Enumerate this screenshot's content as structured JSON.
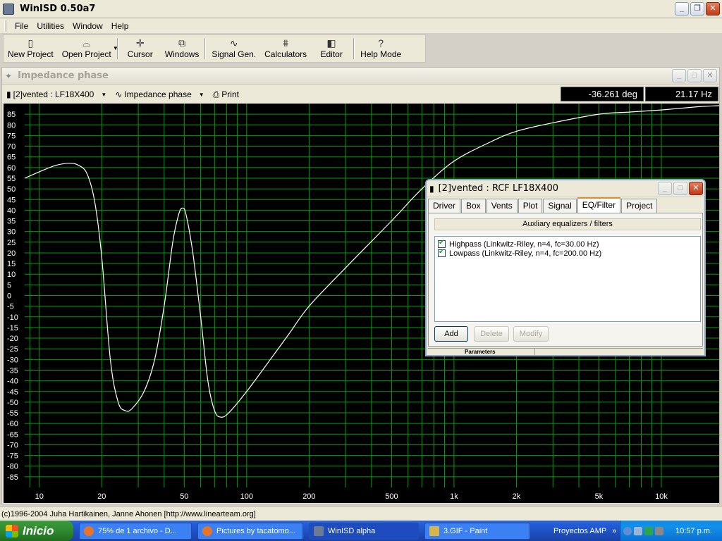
{
  "window": {
    "title": "WinISD 0.50a7"
  },
  "menu": [
    "File",
    "Utilities",
    "Window",
    "Help"
  ],
  "toolbar": [
    {
      "label": "New Project",
      "icon": "new-project-icon"
    },
    {
      "label": "Open Project",
      "icon": "open-project-icon"
    },
    {
      "label": "Cursor",
      "icon": "cursor-icon"
    },
    {
      "label": "Windows",
      "icon": "windows-icon"
    },
    {
      "label": "Signal Gen.",
      "icon": "signal-gen-icon"
    },
    {
      "label": "Calculators",
      "icon": "calculators-icon"
    },
    {
      "label": "Editor",
      "icon": "editor-icon"
    },
    {
      "label": "Help Mode",
      "icon": "help-icon"
    }
  ],
  "plot_window": {
    "title": "Impedance phase",
    "project_select": "[2]vented : LF18X400",
    "graph_select": "Impedance phase",
    "print_label": "Print",
    "cursor_value": "-36.261 deg",
    "cursor_freq": "21.17 Hz"
  },
  "chart_data": {
    "type": "line",
    "xlabel": "",
    "ylabel": "",
    "x_scale": "log",
    "xlim": [
      8.5,
      19000
    ],
    "ylim": [
      -90,
      90
    ],
    "grid": true,
    "y_ticks": [
      85,
      80,
      75,
      70,
      65,
      60,
      55,
      50,
      45,
      40,
      35,
      30,
      25,
      20,
      15,
      10,
      5,
      0,
      -5,
      -10,
      -15,
      -20,
      -25,
      -30,
      -35,
      -40,
      -45,
      -50,
      -55,
      -60,
      -65,
      -70,
      -75,
      -80,
      -85
    ],
    "x_tick_labels": [
      {
        "value": 10,
        "label": "10"
      },
      {
        "value": 20,
        "label": "20"
      },
      {
        "value": 50,
        "label": "50"
      },
      {
        "value": 100,
        "label": "100"
      },
      {
        "value": 200,
        "label": "200"
      },
      {
        "value": 500,
        "label": "500"
      },
      {
        "value": 1000,
        "label": "1k"
      },
      {
        "value": 2000,
        "label": "2k"
      },
      {
        "value": 5000,
        "label": "5k"
      },
      {
        "value": 10000,
        "label": "10k"
      }
    ],
    "series": [
      {
        "color": "#ffffff",
        "points": [
          [
            8.5,
            55
          ],
          [
            10,
            58
          ],
          [
            12,
            61
          ],
          [
            14,
            62
          ],
          [
            15.5,
            61
          ],
          [
            17,
            57
          ],
          [
            18.5,
            44
          ],
          [
            20,
            18
          ],
          [
            22,
            -30
          ],
          [
            24,
            -50
          ],
          [
            26,
            -54
          ],
          [
            28,
            -53
          ],
          [
            32,
            -45
          ],
          [
            36,
            -30
          ],
          [
            40,
            -5
          ],
          [
            44,
            25
          ],
          [
            47,
            38
          ],
          [
            49,
            41
          ],
          [
            51,
            38
          ],
          [
            55,
            20
          ],
          [
            60,
            -10
          ],
          [
            65,
            -40
          ],
          [
            70,
            -54
          ],
          [
            75,
            -57
          ],
          [
            82,
            -55
          ],
          [
            100,
            -45
          ],
          [
            130,
            -30
          ],
          [
            160,
            -18
          ],
          [
            200,
            -5
          ],
          [
            300,
            13
          ],
          [
            500,
            35
          ],
          [
            700,
            50
          ],
          [
            1000,
            63
          ],
          [
            1500,
            72
          ],
          [
            2000,
            77
          ],
          [
            3000,
            81
          ],
          [
            5000,
            85
          ],
          [
            7000,
            86
          ],
          [
            10000,
            87
          ],
          [
            15000,
            88.5
          ],
          [
            19000,
            89
          ]
        ]
      }
    ]
  },
  "status_bar": {
    "text": "(c)1996-2004 Juha Hartikainen, Janne Ahonen [http://www.linearteam.org]"
  },
  "dialog": {
    "title": "[2]vented : RCF LF18X400",
    "tabs": [
      "Driver",
      "Box",
      "Vents",
      "Plot",
      "Signal",
      "EQ/Filter",
      "Project"
    ],
    "active_tab": "EQ/Filter",
    "panel_header": "Auxliary equalizers / filters",
    "filters": [
      {
        "checked": true,
        "label": "Highpass (Linkwitz-Riley, n=4, fc=30.00 Hz)"
      },
      {
        "checked": true,
        "label": "Lowpass (Linkwitz-Riley, n=4, fc=200.00 Hz)"
      }
    ],
    "buttons": {
      "add": "Add",
      "delete": "Delete",
      "modify": "Modify"
    },
    "footer": "Parameters"
  },
  "taskbar": {
    "start_label": "Inicio",
    "tasks": [
      {
        "label": "75% de 1 archivo - D...",
        "icon_color": "#e8742a"
      },
      {
        "label": "Pictures by tacatomo...",
        "icon_color": "#e8742a"
      },
      {
        "label": "WinISD alpha",
        "icon_color": "#6a7b92",
        "active": true
      },
      {
        "label": "3.GIF - Paint",
        "icon_color": "#d9b64a"
      }
    ],
    "quicklaunch_label": "Proyectos AMP",
    "clock": "10:57 p.m."
  },
  "colors": {
    "plot_background": "#000000",
    "grid": "#00a000",
    "axis_text": "#ffffff",
    "curve": "#ffffff",
    "xp_blue": "#245edb"
  }
}
